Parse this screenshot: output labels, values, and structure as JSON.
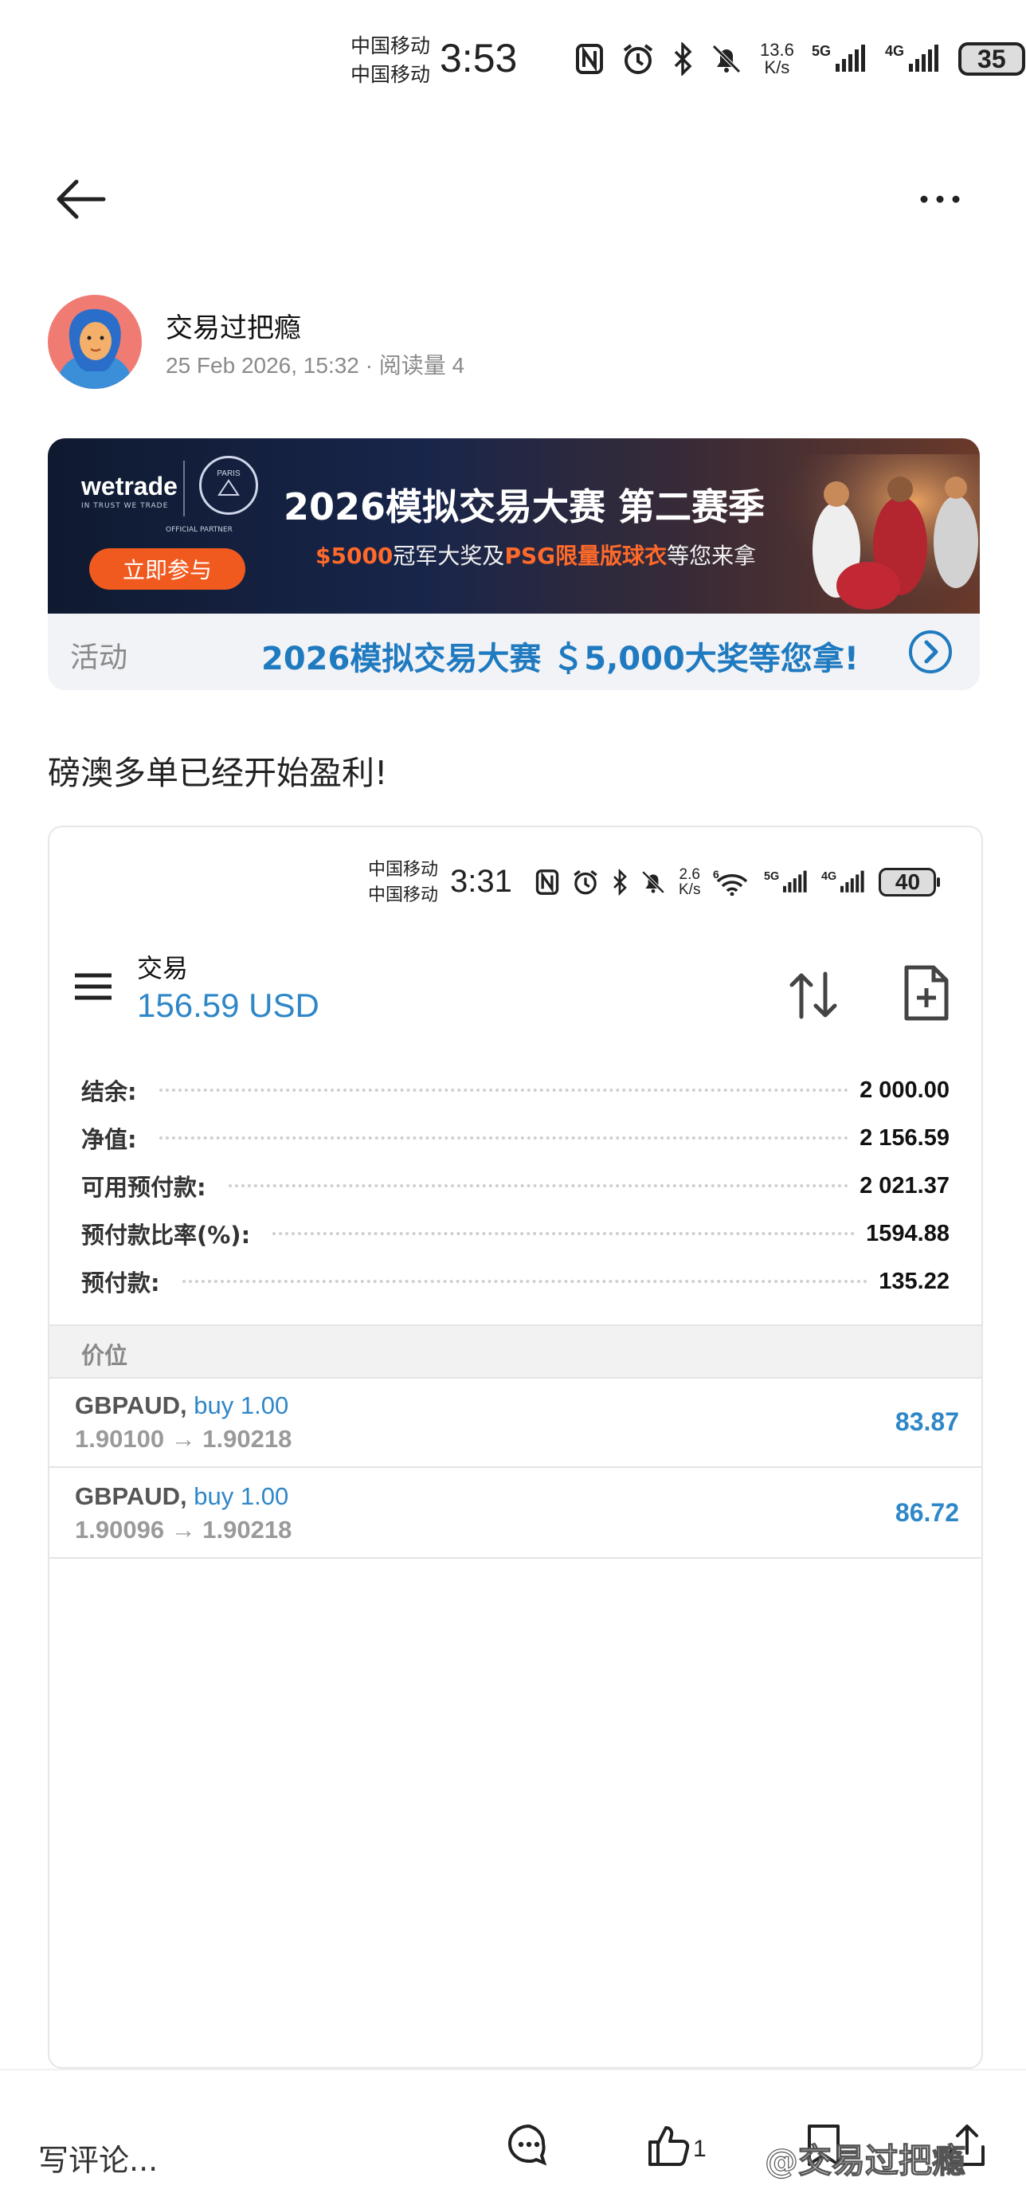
{
  "status_bar": {
    "carrier_1": "中国移动",
    "carrier_2": "中国移动",
    "time": "3:53",
    "net_speed_value": "13.6",
    "net_speed_unit": "K/s",
    "net_5g": "5G",
    "net_4g": "4G",
    "battery": "35"
  },
  "post": {
    "author": "交易过把瘾",
    "meta": "25 Feb 2026, 15:32 · 阅读量 4",
    "text": "磅澳多单已经开始盈利!"
  },
  "banner": {
    "brand": "wetrade",
    "brand_tag": "IN TRUST WE TRADE",
    "partner": "OFFICIAL PARTNER",
    "crest_text": "PARIS",
    "title": "2026模拟交易大赛 第二赛季",
    "sub_prize": "$5000",
    "sub_text_1": "冠军大奖及",
    "sub_psg": "PSG限量版球衣",
    "sub_text_2": "等您来拿",
    "join": "立即参与",
    "activity_tag": "活动",
    "activity_text": "2026模拟交易大赛 ＄5,000大奖等您拿!"
  },
  "screenshot": {
    "status": {
      "carrier_1": "中国移动",
      "carrier_2": "中国移动",
      "time": "3:31",
      "net_speed_value": "2.6",
      "net_speed_unit": "K/s",
      "wifi_tag": "6",
      "net_5g": "5G",
      "net_4g": "4G",
      "battery": "40"
    },
    "title": "交易",
    "profit": "156.59 USD",
    "summary": [
      {
        "label": "结余:",
        "value": "2 000.00"
      },
      {
        "label": "净值:",
        "value": "2 156.59"
      },
      {
        "label": "可用预付款:",
        "value": "2 021.37"
      },
      {
        "label": "预付款比率(%):",
        "value": "1594.88"
      },
      {
        "label": "预付款:",
        "value": "135.22"
      }
    ],
    "positions_header": "价位",
    "positions": [
      {
        "symbol": "GBPAUD,",
        "side": "buy 1.00",
        "prices": "1.90100 → 1.90218",
        "profit": "83.87"
      },
      {
        "symbol": "GBPAUD,",
        "side": "buy 1.00",
        "prices": "1.90096 → 1.90218",
        "profit": "86.72"
      }
    ]
  },
  "bottom_bar": {
    "comment_placeholder": "写评论...",
    "like_count": "1",
    "watermark": "@交易过把瘾"
  },
  "colors": {
    "accent_blue": "#2f87c8",
    "link_blue": "#1f7ac0",
    "orange": "#f05a1f",
    "avatar_bg": "#f07b73"
  },
  "icons": [
    "back-arrow-icon",
    "more-icon",
    "chevron-right-icon",
    "menu-icon",
    "sort-icon",
    "new-document-icon",
    "comment-icon",
    "like-icon",
    "bookmark-icon",
    "share-icon"
  ]
}
